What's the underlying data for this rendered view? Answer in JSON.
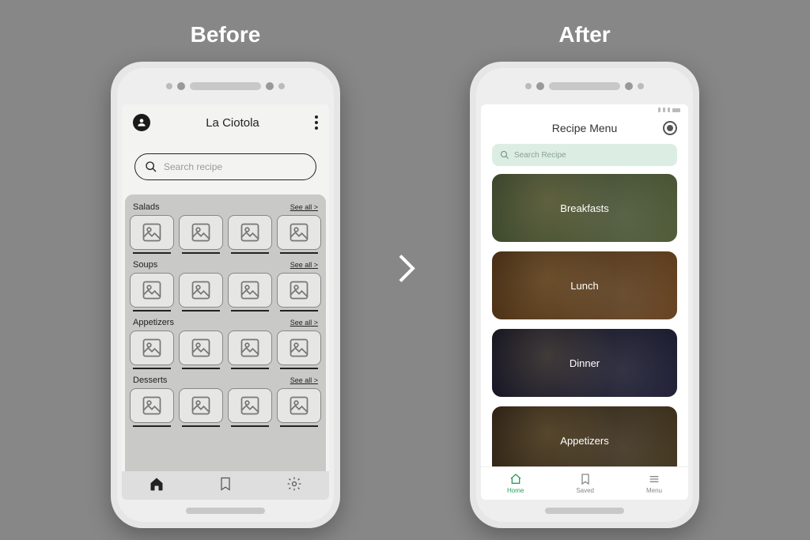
{
  "labels": {
    "before": "Before",
    "after": "After"
  },
  "before": {
    "title": "La Ciotola",
    "search_placeholder": "Search recipe",
    "see_all": "See all >",
    "sections": [
      {
        "title": "Salads"
      },
      {
        "title": "Soups"
      },
      {
        "title": "Appetizers"
      },
      {
        "title": "Desserts"
      }
    ]
  },
  "after": {
    "title": "Recipe Menu",
    "search_placeholder": "Search Recipe",
    "categories": [
      {
        "label": "Breakfasts"
      },
      {
        "label": "Lunch"
      },
      {
        "label": "Dinner"
      },
      {
        "label": "Appetizers"
      }
    ],
    "tabs": [
      {
        "label": "Home"
      },
      {
        "label": "Saved"
      },
      {
        "label": "Menu"
      }
    ]
  }
}
